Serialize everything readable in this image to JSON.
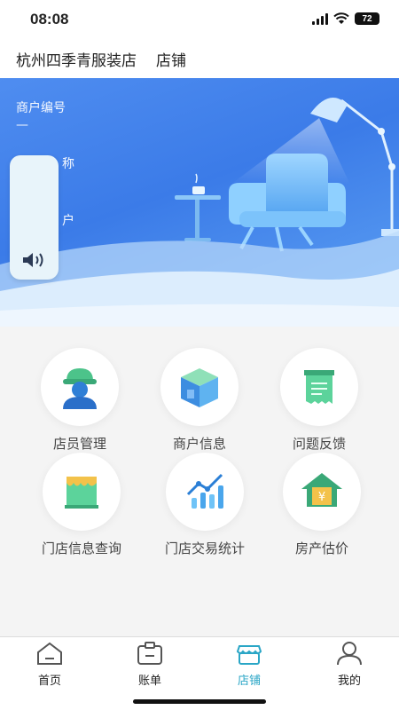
{
  "status_bar": {
    "time": "08:08",
    "battery": "72"
  },
  "header": {
    "store_name": "杭州四季青服装店",
    "page_title": "店铺"
  },
  "hero": {
    "merchant_no_label": "商户编号",
    "merchant_no_value": "—",
    "name_label_partial": "称",
    "account_label_partial": "户"
  },
  "grid": {
    "items": [
      {
        "label": "店员管理",
        "icon": "staff-icon"
      },
      {
        "label": "商户信息",
        "icon": "merchant-cube-icon"
      },
      {
        "label": "问题反馈",
        "icon": "feedback-icon"
      },
      {
        "label": "门店信息查询",
        "icon": "storefront-icon"
      },
      {
        "label": "门店交易统计",
        "icon": "chart-icon"
      },
      {
        "label": "房产估价",
        "icon": "house-yen-icon"
      }
    ]
  },
  "tabbar": {
    "active": "店铺",
    "items": [
      {
        "label": "首页",
        "icon": "home-icon"
      },
      {
        "label": "账单",
        "icon": "bill-icon"
      },
      {
        "label": "店铺",
        "icon": "store-icon"
      },
      {
        "label": "我的",
        "icon": "profile-icon"
      }
    ]
  },
  "colors": {
    "hero_blue": "#3b7be8",
    "accent": "#2aa6c6",
    "icon_green": "#4cc38a"
  }
}
